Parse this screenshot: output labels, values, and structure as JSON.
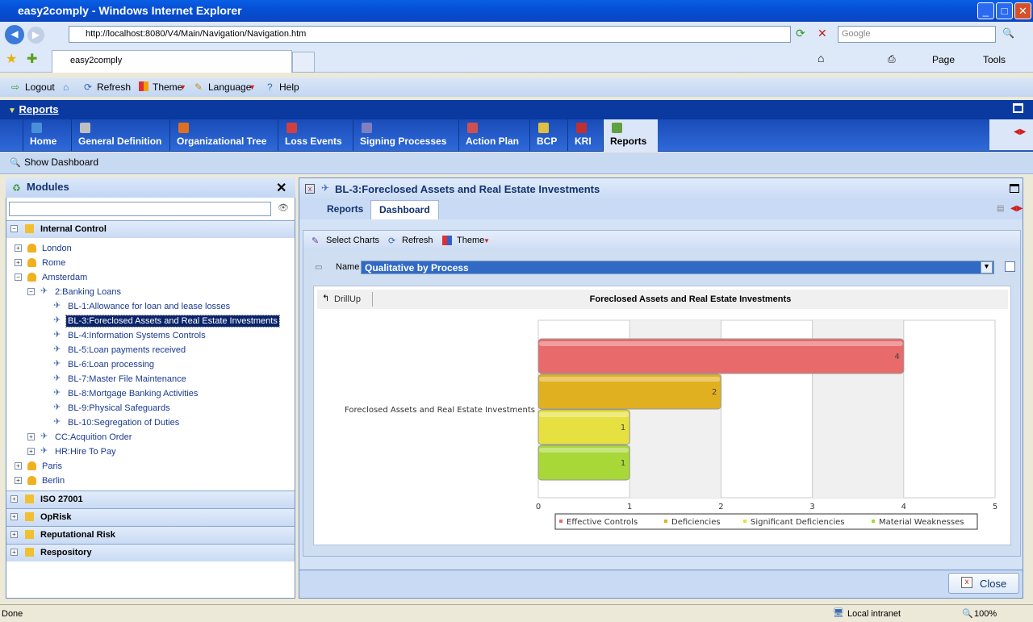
{
  "window": {
    "title": "easy2comply - Windows Internet Explorer",
    "url": "http://localhost:8080/V4/Main/Navigation/Navigation.htm",
    "search_placeholder": "Google",
    "tab": "easy2comply",
    "page_menu": "Page",
    "tools_menu": "Tools"
  },
  "toolbar": {
    "logout": "Logout",
    "refresh": "Refresh",
    "theme": "Theme",
    "language": "Language",
    "help": "Help"
  },
  "header": {
    "title": "Reports"
  },
  "nav": [
    {
      "label": "Home",
      "color": "#4a90d9"
    },
    {
      "label": "General Definition",
      "color": "#c0c0c0"
    },
    {
      "label": "Organizational Tree",
      "color": "#e07020"
    },
    {
      "label": "Loss Events",
      "color": "#d04040"
    },
    {
      "label": "Signing Processes",
      "color": "#8080c0"
    },
    {
      "label": "Action Plan",
      "color": "#d05050"
    },
    {
      "label": "BCP",
      "color": "#e0c040"
    },
    {
      "label": "KRI",
      "color": "#c03030"
    },
    {
      "label": "Reports",
      "color": "#60a040"
    }
  ],
  "show_dashboard": "Show Dashboard",
  "modules": {
    "title": "Modules",
    "search_value": "",
    "section_open": "Internal Control",
    "tree": [
      {
        "label": "London",
        "level": 0,
        "exp": "+",
        "type": "user"
      },
      {
        "label": "Rome",
        "level": 0,
        "exp": "+",
        "type": "user"
      },
      {
        "label": "Amsterdam",
        "level": 0,
        "exp": "-",
        "type": "user"
      },
      {
        "label": "2:Banking Loans",
        "level": 1,
        "exp": "-",
        "type": "proc"
      },
      {
        "label": "BL-1:Allowance for loan and lease losses",
        "level": 2,
        "type": "proc"
      },
      {
        "label": "BL-3:Foreclosed Assets and Real Estate Investments",
        "level": 2,
        "type": "proc",
        "selected": true
      },
      {
        "label": "BL-4:Information Systems Controls",
        "level": 2,
        "type": "proc"
      },
      {
        "label": "BL-5:Loan payments received",
        "level": 2,
        "type": "proc"
      },
      {
        "label": "BL-6:Loan processing",
        "level": 2,
        "type": "proc"
      },
      {
        "label": "BL-7:Master File Maintenance",
        "level": 2,
        "type": "proc"
      },
      {
        "label": "BL-8:Mortgage Banking Activities",
        "level": 2,
        "type": "proc"
      },
      {
        "label": "BL-9:Physical Safeguards",
        "level": 2,
        "type": "proc"
      },
      {
        "label": "BL-10:Segregation of Duties",
        "level": 2,
        "type": "proc"
      },
      {
        "label": "CC:Acquition Order",
        "level": 1,
        "exp": "+",
        "type": "proc"
      },
      {
        "label": "HR:Hire To Pay",
        "level": 1,
        "exp": "+",
        "type": "proc"
      },
      {
        "label": "Paris",
        "level": 0,
        "exp": "+",
        "type": "user"
      },
      {
        "label": "Berlin",
        "level": 0,
        "exp": "+",
        "type": "user"
      }
    ],
    "sections": [
      "ISO 27001",
      "OpRisk",
      "Reputational Risk",
      "Respository"
    ]
  },
  "detail": {
    "title": "BL-3:Foreclosed Assets and Real Estate Investments",
    "tabs": [
      "Reports",
      "Dashboard"
    ],
    "active_tab": "Dashboard",
    "select_charts": "Select Charts",
    "refresh": "Refresh",
    "theme": "Theme",
    "name_label": "Name",
    "name_value": "Qualitative by Process",
    "drillup": "DrillUp",
    "close": "Close"
  },
  "chart_data": {
    "type": "bar",
    "orientation": "horizontal",
    "title": "Foreclosed Assets and Real Estate Investments",
    "categories": [
      "Foreclosed Assets and Real Estate Investments"
    ],
    "series": [
      {
        "name": "Effective Controls",
        "values": [
          4
        ],
        "color": "#e86a6a"
      },
      {
        "name": "Deficiencies",
        "values": [
          2
        ],
        "color": "#e0b020"
      },
      {
        "name": "Significant Deficiencies",
        "values": [
          1
        ],
        "color": "#e6e040"
      },
      {
        "name": "Material Weaknesses",
        "values": [
          1
        ],
        "color": "#a8d838"
      }
    ],
    "xlim": [
      0,
      5
    ],
    "xticks": [
      "0",
      "1",
      "2",
      "3",
      "4",
      "5"
    ],
    "legend": "bottom"
  },
  "status": {
    "left": "Done",
    "zone": "Local intranet",
    "zoom": "100%"
  }
}
